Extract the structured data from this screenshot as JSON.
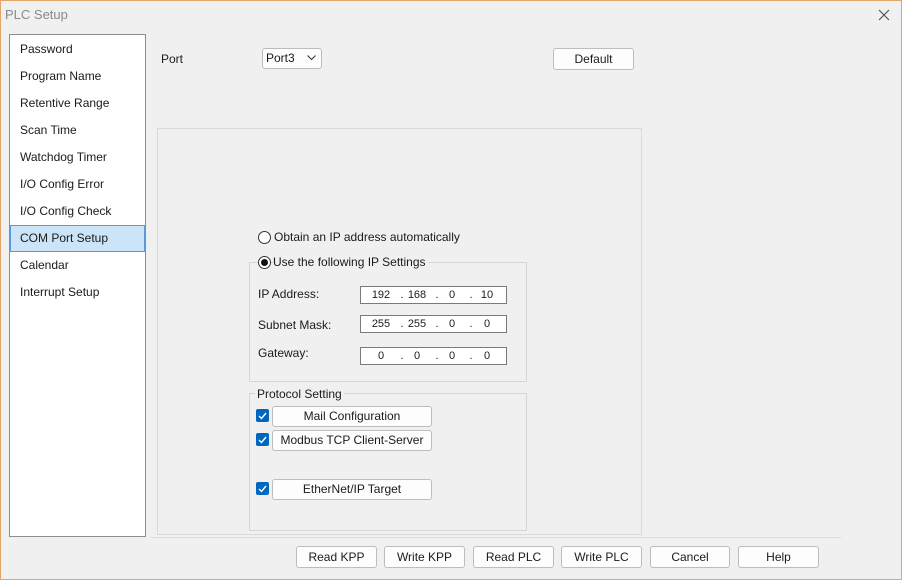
{
  "window": {
    "title": "PLC Setup"
  },
  "nav": {
    "items": [
      {
        "label": "Password"
      },
      {
        "label": "Program Name"
      },
      {
        "label": "Retentive Range"
      },
      {
        "label": "Scan Time"
      },
      {
        "label": "Watchdog Timer"
      },
      {
        "label": "I/O Config Error"
      },
      {
        "label": "I/O Config Check"
      },
      {
        "label": "COM Port Setup"
      },
      {
        "label": "Calendar"
      },
      {
        "label": "Interrupt Setup"
      }
    ],
    "selected": "COM Port Setup"
  },
  "port": {
    "label": "Port",
    "value": "Port3"
  },
  "default_label": "Default",
  "ip": {
    "auto_label": "Obtain an IP address automatically",
    "manual_label": "Use the following IP Settings",
    "address_label": "IP Address:",
    "address": [
      "192",
      "168",
      "0",
      "10"
    ],
    "mask_label": "Subnet Mask:",
    "mask": [
      "255",
      "255",
      "0",
      "0"
    ],
    "gateway_label": "Gateway:",
    "gateway": [
      "0",
      "0",
      "0",
      "0"
    ]
  },
  "protocol": {
    "title": "Protocol Setting",
    "mail": "Mail Configuration",
    "modbus": "Modbus TCP Client-Server",
    "ethernet": "EtherNet/IP Target"
  },
  "footer": {
    "read_kpp": "Read KPP",
    "write_kpp": "Write KPP",
    "read_plc": "Read PLC",
    "write_plc": "Write PLC",
    "cancel": "Cancel",
    "help": "Help"
  },
  "colors": {
    "accent": "#0067c0",
    "selection": "#cce4f7",
    "border_accent": "#e3a66a"
  }
}
